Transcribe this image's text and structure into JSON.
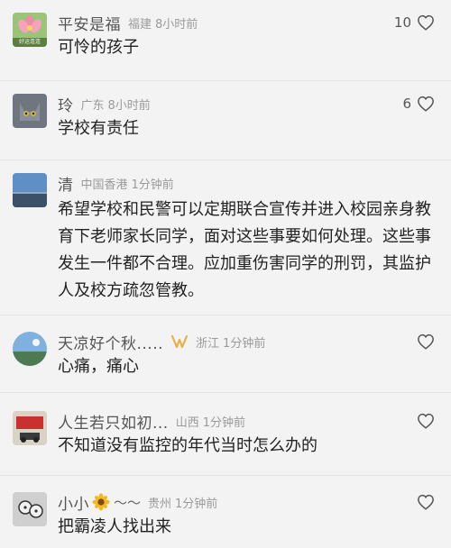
{
  "comments": [
    {
      "user": "平安是福",
      "location": "福建",
      "time": "8小时前",
      "text": "可怜的孩子",
      "likes": "10",
      "avatar_text": "好运连连"
    },
    {
      "user": "玲",
      "location": "广东",
      "time": "8小时前",
      "text": "学校有责任",
      "likes": "6"
    },
    {
      "user": "清",
      "location": "中国香港",
      "time": "1分钟前",
      "text": "希望学校和民警可以定期联合宣传并进入校园亲身教育下老师家长同学，面对这些事要如何处理。这些事发生一件都不合理。应加重伤害同学的刑罚，其监护人及校方疏忽管教。"
    },
    {
      "user": "天凉好个秋.....",
      "location": "浙江",
      "time": "1分钟前",
      "text": "心痛，痛心"
    },
    {
      "user": "人生若只如初...",
      "location": "山西",
      "time": "1分钟前",
      "text": "不知道没有监控的年代当时怎么办的"
    },
    {
      "user": "小小",
      "location": "贵州",
      "time": "1分钟前",
      "text": "把霸凌人找出来",
      "suffix": "～～"
    }
  ],
  "colors": {
    "background": "#f3f3f3",
    "divider": "#e4e4e4",
    "badge": "#e8b04a"
  },
  "icons": {
    "like": "heart-outline-icon",
    "vip": "vip-badge-icon",
    "sunflower": "sunflower-emoji-icon"
  }
}
